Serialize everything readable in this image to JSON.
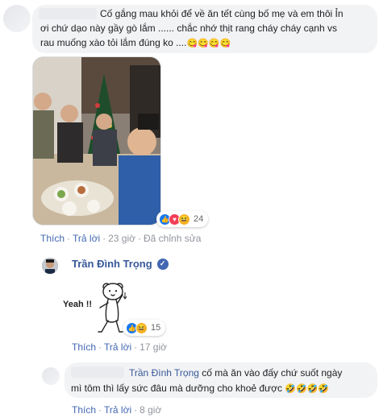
{
  "colors": {
    "link": "#385898",
    "action": "#4267b2",
    "meta": "#90949c",
    "bubble": "#f2f3f5",
    "like": "#1877f2",
    "love": "#f33e58",
    "haha": "#f7b125"
  },
  "comment1": {
    "line1": "Cố gắng mau khỏi để về ăn tết cùng bố mẹ và em thôi Ỉn",
    "line2": "ơi chứ dạo này gầy gò lắm ...... chắc nhớ thịt rang cháy cháy cạnh vs",
    "line3": "rau muống xào tỏi lắm đúng ko ....",
    "emojis": "😋😋😋😋",
    "photo_icon": "family-photo",
    "reactions": {
      "icons": [
        "like-icon",
        "love-icon",
        "haha-icon"
      ],
      "count": "24"
    },
    "actions": {
      "like": "Thích",
      "reply": "Trả lời",
      "time": "23 giờ",
      "edited": "Đã chỉnh sửa"
    }
  },
  "comment2": {
    "author": "Trần Đình Trọng",
    "sticker_text": "Yeah !!",
    "reactions": {
      "icons": [
        "like-icon",
        "haha-icon"
      ],
      "count": "15"
    },
    "actions": {
      "like": "Thích",
      "reply": "Trả lời",
      "time": "17 giờ"
    }
  },
  "comment3": {
    "mention": "Trần Đình Trọng",
    "line1": " cố mà ăn vào đấy chứ suốt ngày",
    "line2": "mì tôm thì lấy sức đâu mà dưỡng cho khoẻ được",
    "emojis": "🤣🤣🤣🤣",
    "actions": {
      "like": "Thích",
      "reply": "Trả lời",
      "time": "8 giờ"
    }
  }
}
